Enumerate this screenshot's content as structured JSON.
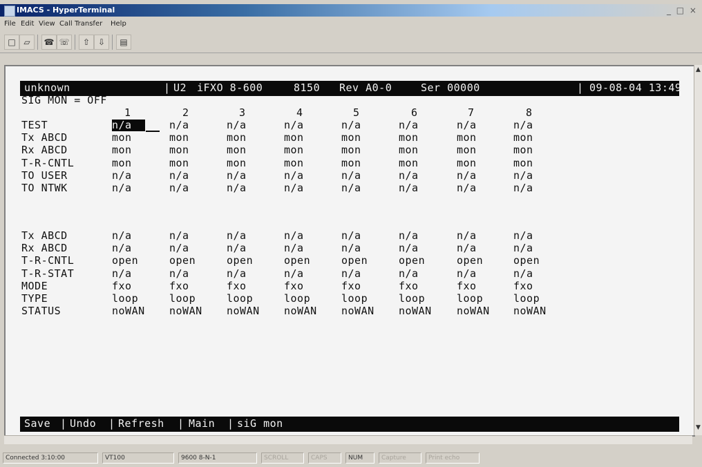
{
  "window": {
    "title": "IMACS - HyperTerminal",
    "controls": "_ □ ×"
  },
  "menu": [
    "File",
    "Edit",
    "View",
    "Call",
    "Transfer",
    "Help"
  ],
  "toolbar": {
    "icons": [
      "new-connection-icon",
      "open-icon",
      "phone-dial-icon",
      "hang-up-icon",
      "send-icon",
      "receive-icon",
      "properties-icon"
    ]
  },
  "terminal": {
    "header": {
      "host": "unknown",
      "slot": "U2",
      "card": "iFXO 8-600",
      "model": "8150",
      "rev": "Rev A0-0",
      "ser": "Ser 00000",
      "datetime": "09-08-04 13:49"
    },
    "sig_mon": "SIG MON = OFF",
    "columns": [
      "1",
      "2",
      "3",
      "4",
      "5",
      "6",
      "7",
      "8"
    ],
    "rows_top": [
      {
        "label": "TEST",
        "values": [
          "n/a",
          "n/a",
          "n/a",
          "n/a",
          "n/a",
          "n/a",
          "n/a",
          "n/a"
        ]
      },
      {
        "label": "Tx ABCD",
        "values": [
          "mon",
          "mon",
          "mon",
          "mon",
          "mon",
          "mon",
          "mon",
          "mon"
        ]
      },
      {
        "label": "Rx ABCD",
        "values": [
          "mon",
          "mon",
          "mon",
          "mon",
          "mon",
          "mon",
          "mon",
          "mon"
        ]
      },
      {
        "label": "T-R-CNTL",
        "values": [
          "mon",
          "mon",
          "mon",
          "mon",
          "mon",
          "mon",
          "mon",
          "mon"
        ]
      },
      {
        "label": "TO USER",
        "values": [
          "n/a",
          "n/a",
          "n/a",
          "n/a",
          "n/a",
          "n/a",
          "n/a",
          "n/a"
        ]
      },
      {
        "label": "TO NTWK",
        "values": [
          "n/a",
          "n/a",
          "n/a",
          "n/a",
          "n/a",
          "n/a",
          "n/a",
          "n/a"
        ]
      }
    ],
    "rows_bottom": [
      {
        "label": "Tx ABCD",
        "values": [
          "n/a",
          "n/a",
          "n/a",
          "n/a",
          "n/a",
          "n/a",
          "n/a",
          "n/a"
        ]
      },
      {
        "label": "Rx ABCD",
        "values": [
          "n/a",
          "n/a",
          "n/a",
          "n/a",
          "n/a",
          "n/a",
          "n/a",
          "n/a"
        ]
      },
      {
        "label": "T-R-CNTL",
        "values": [
          "open",
          "open",
          "open",
          "open",
          "open",
          "open",
          "open",
          "open"
        ]
      },
      {
        "label": "T-R-STAT",
        "values": [
          "n/a",
          "n/a",
          "n/a",
          "n/a",
          "n/a",
          "n/a",
          "n/a",
          "n/a"
        ]
      },
      {
        "label": "MODE",
        "values": [
          "fxo",
          "fxo",
          "fxo",
          "fxo",
          "fxo",
          "fxo",
          "fxo",
          "fxo"
        ]
      },
      {
        "label": "TYPE",
        "values": [
          "loop",
          "loop",
          "loop",
          "loop",
          "loop",
          "loop",
          "loop",
          "loop"
        ]
      },
      {
        "label": "STATUS",
        "values": [
          "noWAN",
          "noWAN",
          "noWAN",
          "noWAN",
          "noWAN",
          "noWAN",
          "noWAN",
          "noWAN"
        ]
      }
    ],
    "footer": [
      "Save",
      "Undo",
      "Refresh",
      "Main",
      "siG mon"
    ]
  },
  "statusbar": {
    "connected": "Connected 3:10:00",
    "emulation": "VT100",
    "settings": "9600 8-N-1",
    "scroll": "SCROLL",
    "caps": "CAPS",
    "num": "NUM",
    "capture": "Capture",
    "print_echo": "Print echo"
  },
  "colors": {
    "terminal_bg": "#f4f4f4",
    "terminal_fg": "#111111",
    "bar_bg": "#0a0a0a",
    "bar_fg": "#f2f2f2",
    "chrome": "#d4d0c8"
  }
}
